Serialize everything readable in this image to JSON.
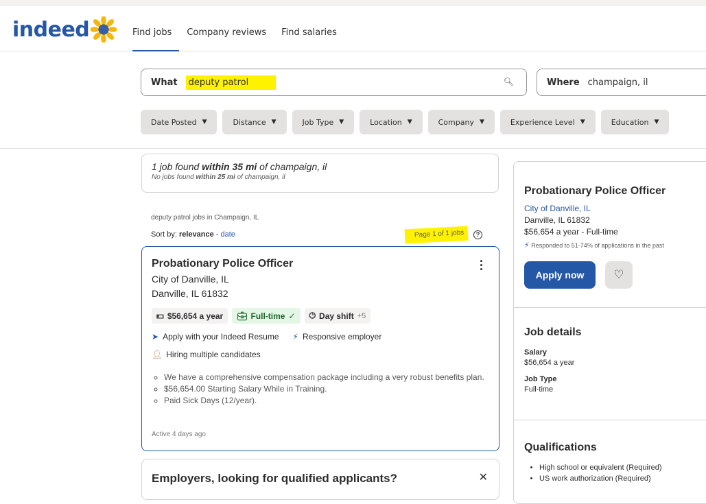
{
  "header": {
    "logo": "indeed",
    "nav": [
      "Find jobs",
      "Company reviews",
      "Find salaries"
    ]
  },
  "search": {
    "what_label": "What",
    "what_value": "deputy patrol",
    "where_label": "Where",
    "where_value": "champaign, il"
  },
  "filters": [
    "Date Posted",
    "Distance",
    "Job Type",
    "Location",
    "Company",
    "Experience Level",
    "Education"
  ],
  "results": {
    "count_line_pre": "1 job found ",
    "count_line_bold": "within 35 mi",
    "count_line_post": " of champaign, il",
    "none_line_pre": "No jobs found ",
    "none_line_bold": "within 25 mi",
    "none_line_post": " of champaign, il",
    "jobs_in": "deputy patrol jobs in Champaign, IL",
    "sort_label": "Sort by: ",
    "sort_relevance": "relevance",
    "sort_sep": " - ",
    "sort_date": "date",
    "page_of": "Page 1 of 1 jobs",
    "help": "?"
  },
  "job": {
    "title": "Probationary Police Officer",
    "company": "City of Danville, IL",
    "location": "Danville, IL 61832",
    "salary": "$56,654 a year",
    "type": "Full-time",
    "shift": "Day shift",
    "shift_more": "+5",
    "apply_resume": "Apply with your Indeed Resume",
    "responsive": "Responsive employer",
    "hiring": "Hiring multiple candidates",
    "snippet": [
      "We have a comprehensive compensation package including a very robust benefits plan.",
      "$56,654.00 Starting Salary While in Training.",
      "Paid Sick Days (12/year)."
    ],
    "active": "Active 4 days ago"
  },
  "employer_card": {
    "title": "Employers, looking for qualified applicants?"
  },
  "detail": {
    "title": "Probationary Police Officer",
    "company": "City of Danville, IL",
    "location": "Danville, IL 61832",
    "salary_type": "$56,654 a year  - Full-time",
    "responded": "Responded to 51-74% of applications in the past",
    "apply": "Apply now",
    "job_details": "Job details",
    "salary_label": "Salary",
    "salary_value": "$56,654 a year",
    "jobtype_label": "Job Type",
    "jobtype_value": "Full-time",
    "qualifications": "Qualifications",
    "quals": [
      "High school or equivalent (Required)",
      "US work authorization (Required)"
    ]
  },
  "colors": {
    "brand": "#2557a7",
    "highlight": "#fff200"
  }
}
